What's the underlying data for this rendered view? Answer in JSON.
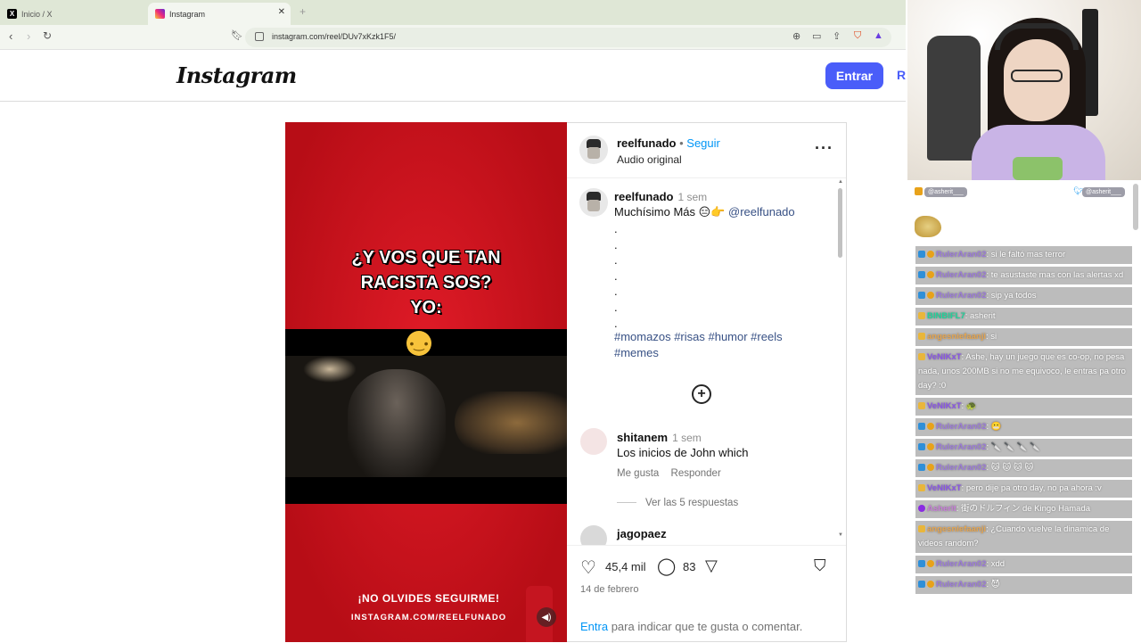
{
  "browser": {
    "tabs": [
      {
        "label": "Inicio / X",
        "icon": "x-logo-icon"
      },
      {
        "label": "Instagram",
        "icon": "instagram-icon"
      }
    ],
    "url": "instagram.com/reel/DUv7xKzk1F5/"
  },
  "header": {
    "logo": "Instagram",
    "login_button": "Entrar",
    "register_cut": "R"
  },
  "video": {
    "caption_lines": [
      "¿Y VOS QUE TAN",
      "RACISTA SOS?",
      "YO:"
    ],
    "promo_line1": "¡NO OLVIDES SEGUIRME!",
    "promo_line2": "INSTAGRAM.COM/REELFUNADO"
  },
  "post": {
    "username": "reelfunado",
    "separator": "•",
    "follow": "Seguir",
    "audio": "Audio original",
    "caption": {
      "username": "reelfunado",
      "time": "1 sem",
      "text": "Muchísimo Más 😑👉",
      "mention": "@reelfunado",
      "dots": [
        ".",
        ".",
        ".",
        ".",
        ".",
        ".",
        "."
      ],
      "hashtags_line1": "#momazos #risas #humor #reels",
      "hashtags_line2": "#memes"
    },
    "comments": [
      {
        "username": "shitanem",
        "time": "1 sem",
        "text": "Los inicios de John which",
        "like": "Me gusta",
        "reply": "Responder",
        "view_replies": "Ver las 5 respuestas"
      },
      {
        "username": "jagopaez"
      }
    ],
    "likes": "45,4 mil",
    "comment_count": "83",
    "date": "14 de febrero",
    "login_link": "Entra",
    "login_text": " para indicar que te gusta o comentar."
  },
  "overlay": {
    "badge_left": "@asherit___",
    "badge_right": "@asherit___",
    "messages": [
      {
        "badges": [
          "b1",
          "b2"
        ],
        "name": "RulerAran02",
        "name_color": "#9b7ad8",
        "text": ": si le faltó mas terror"
      },
      {
        "badges": [
          "b1",
          "b2"
        ],
        "name": "RulerAran02",
        "name_color": "#9b7ad8",
        "text": ": te asustaste mas con las alertas xd"
      },
      {
        "badges": [
          "b1",
          "b2"
        ],
        "name": "RulerAran02",
        "name_color": "#9b7ad8",
        "text": ": sip ya todos"
      },
      {
        "badges": [
          "b3"
        ],
        "name": "BINBIFL7",
        "name_color": "#1fd39a",
        "text": ": asherit"
      },
      {
        "badges": [
          "b3"
        ],
        "name": "angesniefaanji",
        "name_color": "#e7a54e",
        "text": ": si"
      },
      {
        "badges": [
          "b3"
        ],
        "name": "VeNIKxT",
        "name_color": "#8a55e6",
        "text": ": Ashe, hay un juego que es co-op, no pesa nada, unos 200MB si no me equivoco, le entras pa otro day? :0"
      },
      {
        "badges": [
          "b3"
        ],
        "name": "VeNIKxT",
        "name_color": "#8a55e6",
        "text": ": 🐢"
      },
      {
        "badges": [
          "b1",
          "b2"
        ],
        "name": "RulerAran02",
        "name_color": "#9b7ad8",
        "text": ": 😬"
      },
      {
        "badges": [
          "b1",
          "b2"
        ],
        "name": "RulerAran02",
        "name_color": "#9b7ad8",
        "text": ": 🔪 🔪 🔪 🔪"
      },
      {
        "badges": [
          "b1",
          "b2"
        ],
        "name": "RulerAran02",
        "name_color": "#9b7ad8",
        "text": ": 🐱 🐱 🐱 🐱"
      },
      {
        "badges": [
          "b3"
        ],
        "name": "VeNIKxT",
        "name_color": "#8a55e6",
        "text": ": pero dije pa otro day, no pa ahora :v"
      },
      {
        "badges": [
          "b4"
        ],
        "name": "Asherit",
        "name_color": "#c77dd8",
        "text": ": 街のドルフィン de Kingo Hamada"
      },
      {
        "badges": [
          "b3"
        ],
        "name": "angesniefaanji",
        "name_color": "#e7a54e",
        "text": ": ¿Cuando vuelve la dinamica de videos random?"
      },
      {
        "badges": [
          "b1",
          "b2"
        ],
        "name": "RulerAran02",
        "name_color": "#9b7ad8",
        "text": ": xdd"
      },
      {
        "badges": [
          "b1",
          "b2"
        ],
        "name": "RulerAran02",
        "name_color": "#9b7ad8",
        "text": ": 😈"
      }
    ]
  },
  "colors": {
    "ig_blue": "#0095f6",
    "entrar_button": "#4a5df9",
    "video_red": "#d3141f",
    "chat_bg": "#bcbcbc"
  }
}
